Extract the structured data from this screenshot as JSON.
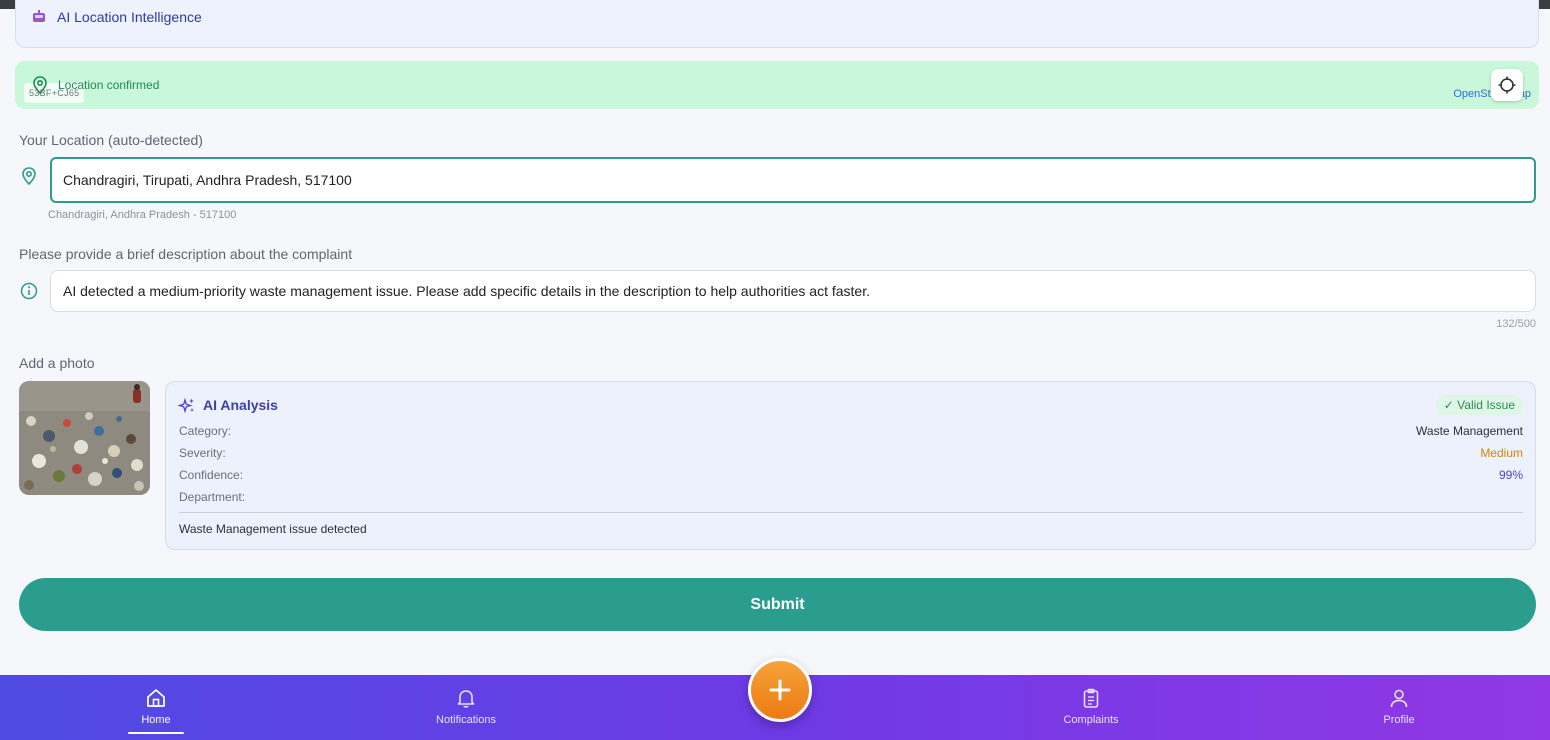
{
  "ai_location_card": {
    "title": "AI Location Intelligence",
    "icon": "robot-icon"
  },
  "map": {
    "status": "Location confirmed",
    "plus_code": "53BF+CJ65",
    "attribution": "OpenStreetMap",
    "status_color": "#1f8a5b"
  },
  "location": {
    "label": "Your Location (auto-detected)",
    "value": "Chandragiri, Tirupati, Andhra Pradesh, 517100",
    "subtext": "Chandragiri, Andhra Pradesh - 517100"
  },
  "description": {
    "label": "Please provide a brief description about the complaint",
    "value": "AI detected a medium-priority waste management issue. Please add specific details in the description to help authorities act faster.",
    "counter": "132/500"
  },
  "photo": {
    "label": "Add a photo"
  },
  "analysis": {
    "title": "AI Analysis",
    "badge": "✓ Valid Issue",
    "rows": [
      {
        "key": "Category:",
        "value": "Waste Management"
      },
      {
        "key": "Severity:",
        "value": "Medium"
      },
      {
        "key": "Confidence:",
        "value": "99%"
      },
      {
        "key": "Department:",
        "value": ""
      }
    ],
    "summary": "Waste Management issue detected",
    "severity_color": "#d4820d",
    "confidence_color": "#4a47c2"
  },
  "submit_label": "Submit",
  "nav": {
    "items": [
      {
        "label": "Home",
        "icon": "home-icon",
        "active": true
      },
      {
        "label": "Notifications",
        "icon": "bell-icon",
        "active": false
      },
      {
        "label": "Complaints",
        "icon": "clipboard-icon",
        "active": false
      },
      {
        "label": "Profile",
        "icon": "user-icon",
        "active": false
      }
    ],
    "fab_icon": "plus-icon"
  },
  "colors": {
    "primary": "#2a9d8f",
    "nav_gradient_start": "#4f4be3",
    "nav_gradient_end": "#9138e4",
    "fab": "#f18d22",
    "map_bg": "#c9f7d9"
  }
}
